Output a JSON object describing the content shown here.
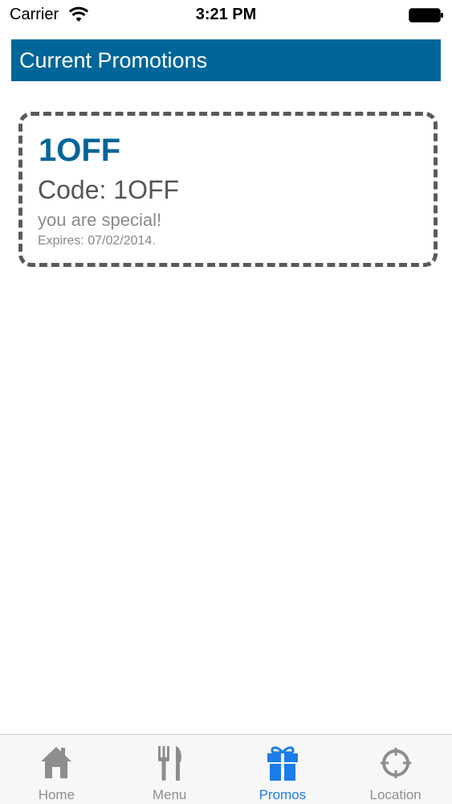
{
  "status_bar": {
    "carrier": "Carrier",
    "time": "3:21 PM"
  },
  "header": {
    "title": "Current Promotions",
    "color": "#006699"
  },
  "promotions": [
    {
      "name": "1OFF",
      "code": "Code: 1OFF",
      "description": "you are special!",
      "expires": "Expires: 07/02/2014."
    }
  ],
  "tab_bar": {
    "active_color": "#1a7de8",
    "inactive_color": "#8e8e8e",
    "tabs": [
      {
        "label": "Home",
        "icon": "house-icon",
        "active": false
      },
      {
        "label": "Menu",
        "icon": "fork-knife-icon",
        "active": false
      },
      {
        "label": "Promos",
        "icon": "gift-icon",
        "active": true
      },
      {
        "label": "Location",
        "icon": "crosshair-icon",
        "active": false
      }
    ]
  }
}
